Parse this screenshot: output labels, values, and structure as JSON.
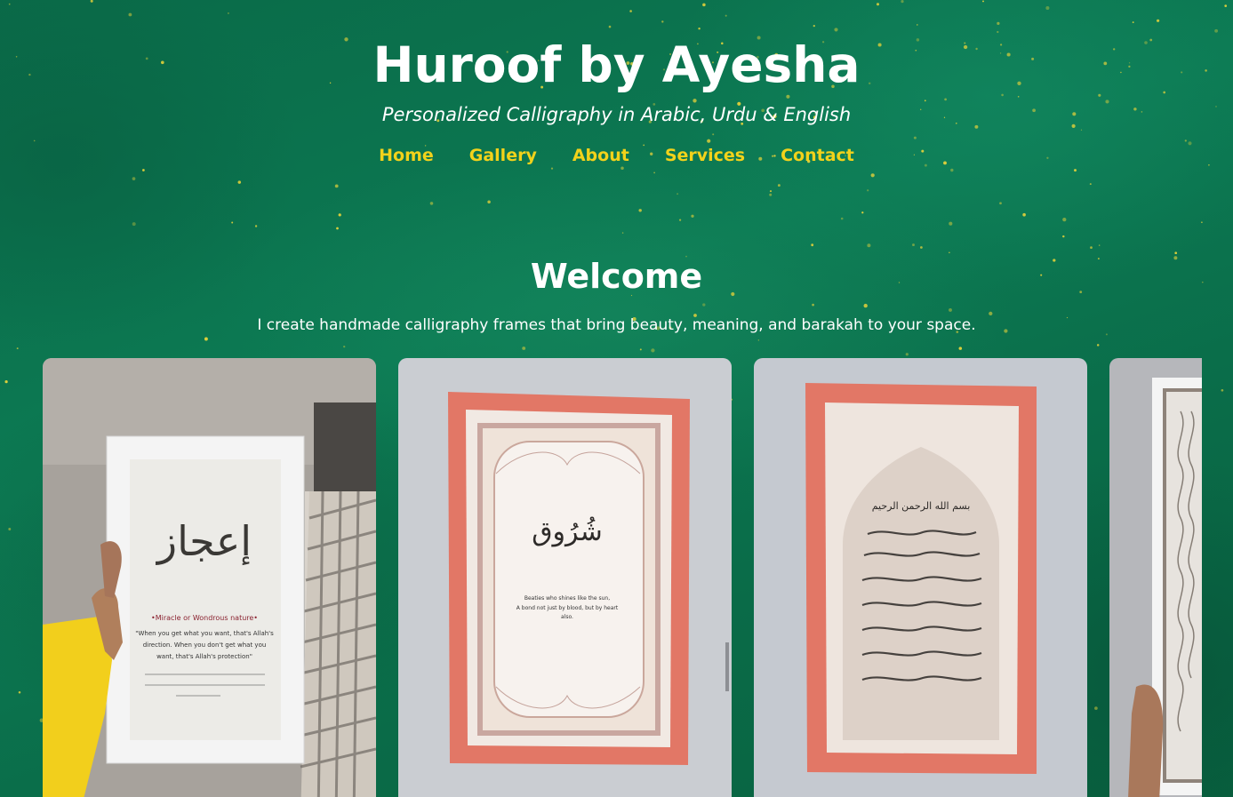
{
  "site": {
    "title": "Huroof by Ayesha",
    "tagline": "Personalized Calligraphy in Arabic, Urdu & English"
  },
  "nav": {
    "items": [
      {
        "label": "Home"
      },
      {
        "label": "Gallery"
      },
      {
        "label": "About"
      },
      {
        "label": "Services"
      },
      {
        "label": "Contact"
      }
    ]
  },
  "welcome": {
    "title": "Welcome",
    "text": "I create handmade calligraphy frames that bring beauty, meaning, and barakah to your space."
  },
  "gallery": {
    "items": [
      {
        "arabic": "إعجاز",
        "subtitle": "•Miracle or Wondrous nature•",
        "quote_lines": [
          "\"When you get what you want, that's Allah's",
          "direction. When you don't get what you",
          "want, that's Allah's protection\""
        ],
        "frame_color": "#f4f4f4"
      },
      {
        "arabic": "شُرُوق",
        "caption_lines": [
          "Beaties who shines like the sun,",
          "A bond not just by blood, but by heart",
          "also."
        ],
        "frame_color": "#e57a6a"
      },
      {
        "arabic": "بسم الله الرحمن الرحيم",
        "frame_color": "#e57a6a"
      },
      {
        "frame_color": "#f4f4f4"
      }
    ]
  },
  "colors": {
    "background": "#0b6e4b",
    "nav_link": "#f2d21b",
    "text": "#ffffff"
  }
}
